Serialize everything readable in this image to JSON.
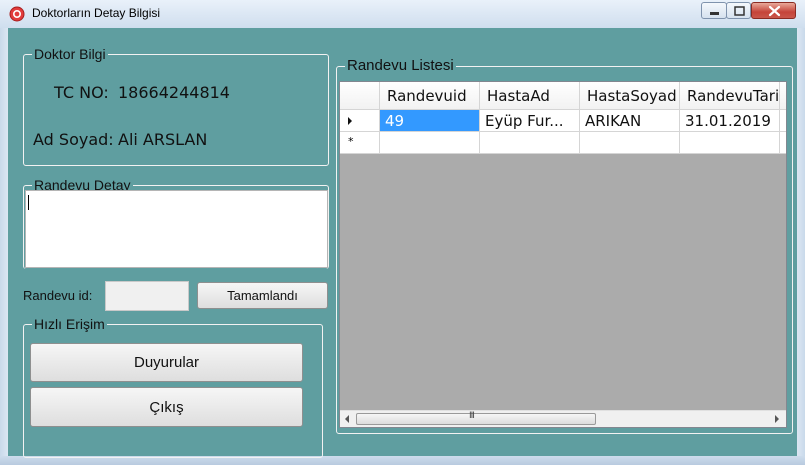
{
  "window": {
    "title": "Doktorların Detay Bilgisi",
    "colors": {
      "background": "#5f9ea0",
      "selection": "#3399ff",
      "close_button": "#c5443a"
    }
  },
  "doctor_info": {
    "group_title": "Doktor Bilgi",
    "tc_label": "TC NO:",
    "tc_value": "18664244814",
    "name_label": "Ad Soyad:",
    "name_value": "Ali ARSLAN"
  },
  "appointment_detail": {
    "group_title": "Randevu Detay",
    "text": ""
  },
  "appointment_id": {
    "label": "Randevu id:",
    "value": "",
    "complete_button": "Tamamlandı"
  },
  "quick_access": {
    "group_title": "Hızlı Erişim",
    "announcements_button": "Duyurular",
    "exit_button": "Çıkış"
  },
  "appointment_list": {
    "group_title": "Randevu Listesi",
    "columns": [
      "Randevuid",
      "HastaAd",
      "HastaSoyad",
      "RandevuTarih"
    ],
    "rows": [
      [
        "49",
        "Eyüp Fur...",
        "ARIKAN",
        "31.01.2019"
      ]
    ],
    "new_row_marker": "*",
    "scroll_grip": "III"
  },
  "icons": [
    "app-icon",
    "minimize-icon",
    "maximize-icon",
    "close-icon",
    "row-pointer-icon",
    "scroll-left-icon",
    "scroll-right-icon"
  ]
}
